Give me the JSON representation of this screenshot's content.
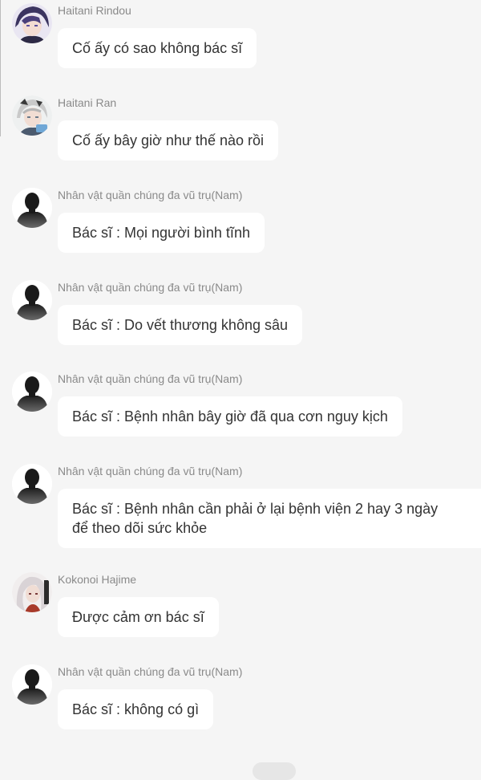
{
  "messages": [
    {
      "name": "Haitani Rindou",
      "text": "Cố ấy có sao không bác sĩ",
      "avatar": "anime-purple-hair-avatar"
    },
    {
      "name": "Haitani Ran",
      "text": "Cố ấy bây giờ như thế nào rồi",
      "avatar": "anime-braided-hair-avatar"
    },
    {
      "name": "Nhân vật quần chúng đa vũ trụ(Nam)",
      "text": "Bác sĩ : Mọi người bình tĩnh",
      "avatar": "silhouette-avatar"
    },
    {
      "name": "Nhân vật quần chúng đa vũ trụ(Nam)",
      "text": "Bác sĩ : Do vết thương không sâu",
      "avatar": "silhouette-avatar"
    },
    {
      "name": "Nhân vật quần chúng đa vũ trụ(Nam)",
      "text": "Bác sĩ : Bệnh nhân bây giờ đã qua cơn nguy kịch",
      "avatar": "silhouette-avatar"
    },
    {
      "name": "Nhân vật quần chúng đa vũ trụ(Nam)",
      "text": "Bác sĩ : Bệnh nhân cần phải ở lại bệnh viện 2 hay 3 ngày để theo dõi sức khỏe",
      "avatar": "silhouette-avatar"
    },
    {
      "name": "Kokonoi Hajime",
      "text": "Được cảm ơn bác sĩ",
      "avatar": "anime-white-hair-avatar"
    },
    {
      "name": "Nhân vật quần chúng đa vũ trụ(Nam)",
      "text": "Bác sĩ : không có gì",
      "avatar": "silhouette-avatar"
    }
  ],
  "colors": {
    "background": "#f5f5f5",
    "bubble": "#ffffff",
    "name_text": "#8a8a8a",
    "message_text": "#333333"
  }
}
